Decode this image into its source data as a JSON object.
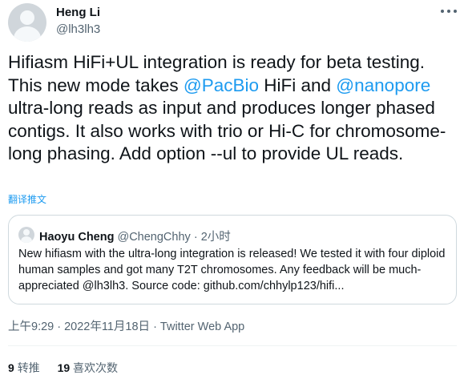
{
  "author": {
    "name": "Heng Li",
    "handle": "@lh3lh3"
  },
  "tweet": {
    "text_parts": [
      "Hifiasm HiFi+UL integration is ready for beta testing. This new mode takes ",
      "@PacBio",
      " HiFi and ",
      "@nanopore",
      " ultra-long reads as input and produces longer phased contigs. It also works with trio or Hi-C for chromosome-long phasing. Add option --ul to provide UL reads."
    ],
    "translate_label": "翻译推文"
  },
  "quoted_tweet": {
    "name": "Haoyu Cheng",
    "handle": "@ChengChhy",
    "separator": " · ",
    "time": "2小时",
    "text": "New hifiasm with the ultra-long integration is released! We tested it with four diploid human samples and got many T2T chromosomes. Any feedback will be much-appreciated @lh3lh3. Source code: github.com/chhylp123/hifi..."
  },
  "timestamp": "上午9:29 · 2022年11月18日 · Twitter Web App",
  "stats": {
    "retweets_count": "9",
    "retweets_label": "转推",
    "likes_count": "19",
    "likes_label": "喜欢次数"
  },
  "icons": {
    "more": "more-dots-icon"
  }
}
